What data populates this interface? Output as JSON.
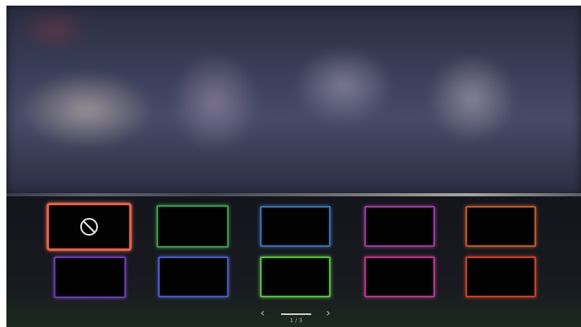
{
  "tiles": [
    {
      "name": "tile-none",
      "selected": true,
      "icon": "no-effect-icon",
      "color": "#e0624c"
    },
    {
      "name": "tile-green-1",
      "selected": false,
      "icon": "",
      "color": "#3a9a4a"
    },
    {
      "name": "tile-blue-1",
      "selected": false,
      "icon": "",
      "color": "#3a6eb0"
    },
    {
      "name": "tile-purple-1",
      "selected": false,
      "icon": "",
      "color": "#9a3a9a"
    },
    {
      "name": "tile-orange-1",
      "selected": false,
      "icon": "",
      "color": "#b8582a"
    },
    {
      "name": "tile-violet-1",
      "selected": false,
      "icon": "",
      "color": "#6a3aa8"
    },
    {
      "name": "tile-indigo-1",
      "selected": false,
      "icon": "",
      "color": "#4a5ab8"
    },
    {
      "name": "tile-green-2",
      "selected": false,
      "icon": "",
      "color": "#5ab84a"
    },
    {
      "name": "tile-magenta-1",
      "selected": false,
      "icon": "",
      "color": "#b0388a"
    },
    {
      "name": "tile-orange-2",
      "selected": false,
      "icon": "",
      "color": "#c0442a"
    }
  ],
  "pager": {
    "prev_icon": "chevron-left-icon",
    "next_icon": "chevron-right-icon",
    "label": "1 / 3"
  }
}
